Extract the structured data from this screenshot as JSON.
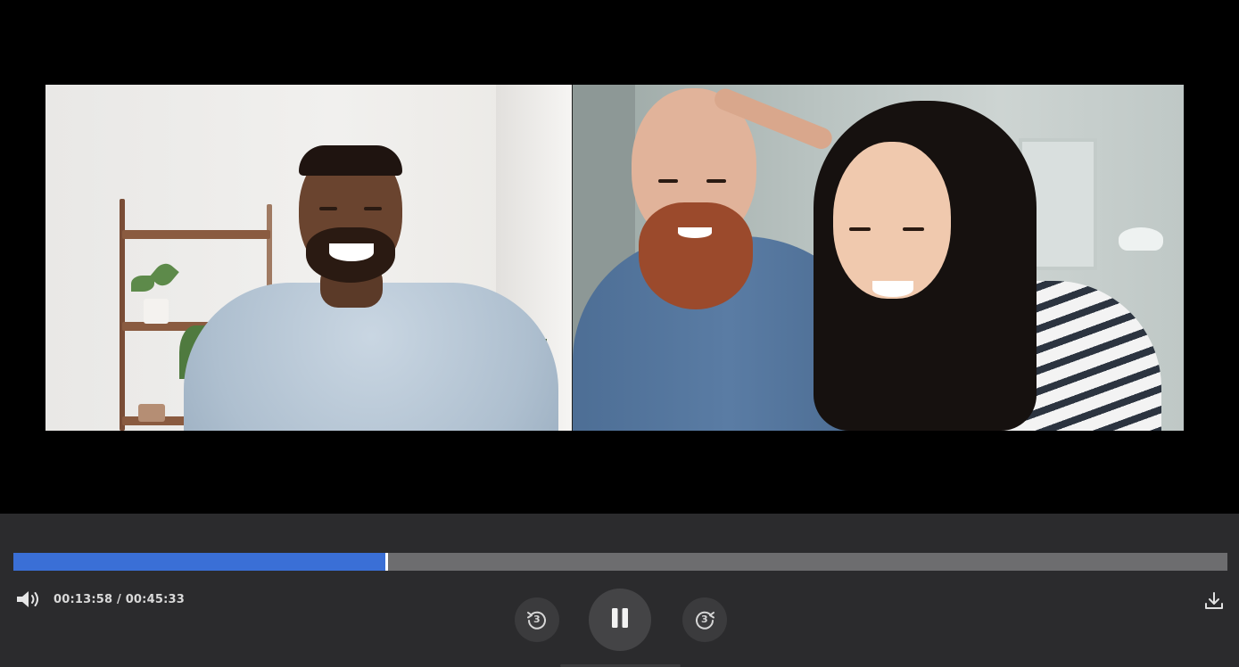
{
  "player": {
    "current_time": "00:13:58",
    "separator": " / ",
    "duration": "00:45:33",
    "progress_fraction": 0.307,
    "skip_back_seconds": "3",
    "skip_forward_seconds": "3"
  },
  "icons": {
    "volume": "volume-icon",
    "rewind": "rewind-icon",
    "pause": "pause-icon",
    "forward": "forward-icon",
    "download": "download-icon"
  },
  "colors": {
    "progress_fill": "#3a6fd6",
    "progress_track": "#6d6d6f",
    "controls_bg": "#2b2b2d"
  }
}
